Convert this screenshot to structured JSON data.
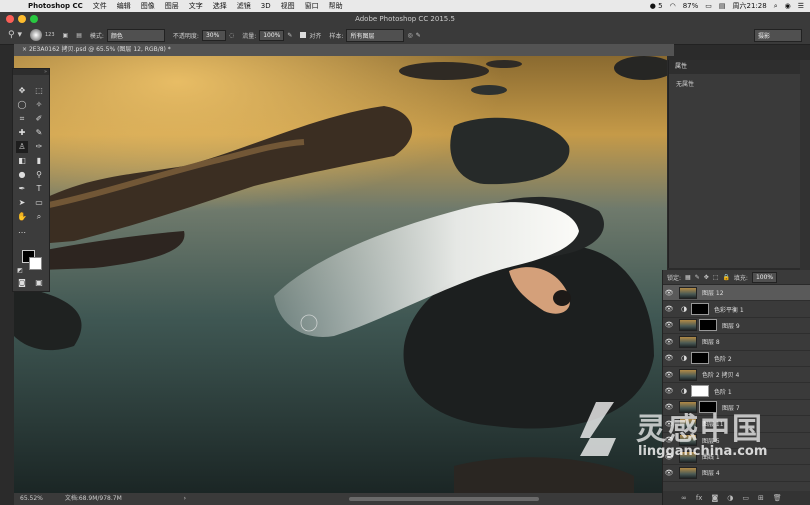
{
  "menubar": {
    "app_name": "Photoshop CC",
    "items": [
      "文件",
      "编辑",
      "图像",
      "图层",
      "文字",
      "选择",
      "滤镜",
      "3D",
      "视图",
      "窗口",
      "帮助"
    ],
    "status": {
      "battery": "87%",
      "clock": "周六21:28",
      "wechat_badge": "5"
    }
  },
  "window": {
    "title": "Adobe Photoshop CC 2015.5"
  },
  "options_bar": {
    "brush_size": "123",
    "mode_label": "模式:",
    "mode_value": "颜色",
    "opacity_label": "不透明度:",
    "opacity_value": "30%",
    "flow_label": "流量:",
    "flow_value": "100%",
    "align_label": "对齐",
    "sample_label": "样本:",
    "sample_value": "所有图层",
    "workspace": "摄影"
  },
  "document": {
    "tab_title": "2E3A0162 拷贝.psd @ 65.5% (图层 12, RGB/8) *"
  },
  "statusbar": {
    "zoom": "65.52%",
    "doc_info": "文档:68.9M/978.7M"
  },
  "properties_panel": {
    "title": "属性",
    "empty_text": "无属性"
  },
  "layers_panel": {
    "lock_label": "锁定:",
    "fill_label": "填充:",
    "fill_value": "100%",
    "layers": [
      {
        "name": "图层 12",
        "kind": "photo",
        "selected": true
      },
      {
        "name": "色彩平衡 1",
        "kind": "adjust",
        "mask": "black"
      },
      {
        "name": "图层 9",
        "kind": "photo",
        "mask": "black"
      },
      {
        "name": "图层 8",
        "kind": "photo"
      },
      {
        "name": "色阶 2",
        "kind": "adjust",
        "mask": "black"
      },
      {
        "name": "色阶 2 拷贝 4",
        "kind": "photo"
      },
      {
        "name": "色阶 1",
        "kind": "adjust",
        "mask": "white"
      },
      {
        "name": "图层 7",
        "kind": "photo",
        "mask": "black"
      },
      {
        "name": "图层 11",
        "kind": "photo"
      },
      {
        "name": "图层 5",
        "kind": "photo"
      },
      {
        "name": "曲线 1",
        "kind": "photo"
      },
      {
        "name": "图层 4",
        "kind": "photo"
      }
    ]
  },
  "watermark": {
    "brand_cn": "灵感中国",
    "url": "lingganchina.com"
  },
  "colors": {
    "accent": "#5a5a5a",
    "panel": "#3a3a3a",
    "menubar": "#e9e9e9"
  }
}
